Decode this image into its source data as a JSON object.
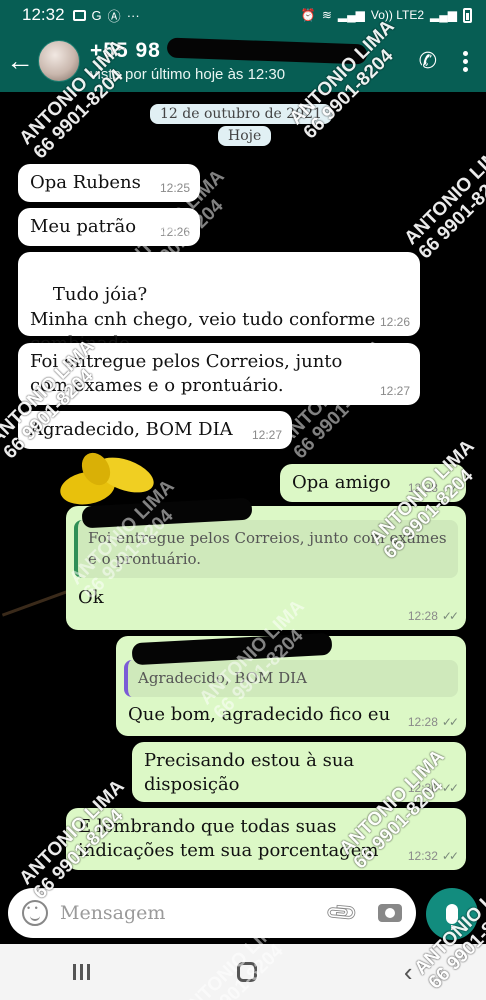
{
  "status_bar": {
    "time": "12:32",
    "icons": [
      "image-icon",
      "google-icon",
      "a-icon",
      "more-icon"
    ],
    "network": "Vo)) LTE2"
  },
  "header": {
    "phone_prefix": "+55 98",
    "last_seen": "visto por último hoje às 12:30"
  },
  "chat": {
    "date_label": "12 de outubro de 2021",
    "today_label": "Hoje",
    "messages": [
      {
        "dir": "in",
        "text": "Opa Rubens",
        "time": "12:25"
      },
      {
        "dir": "in",
        "text": "Meu patrão",
        "time": "12:26"
      },
      {
        "dir": "in",
        "text": "Tudo jóia?\nMinha cnh chego, veio tudo conforme combinado.",
        "time": "12:26"
      },
      {
        "dir": "in",
        "text": "Foi entregue pelos Correios, junto com exames e o prontuário.",
        "time": "12:27"
      },
      {
        "dir": "in",
        "text": "Agradecido, BOM DIA",
        "time": "12:27"
      },
      {
        "dir": "out",
        "text": "Opa amigo",
        "time": "12:28"
      },
      {
        "dir": "out",
        "quote": "Foi entregue pelos Correios, junto com exames e o prontuário.",
        "text": "Ok",
        "time": "12:28"
      },
      {
        "dir": "out",
        "quote": "Agradecido, BOM DIA",
        "text": "Que bom, agradecido fico eu",
        "time": "12:28"
      },
      {
        "dir": "out",
        "text": "Precisando estou à sua disposição",
        "time": "12:30"
      },
      {
        "dir": "out",
        "text": "E lembrando que todas suas indicações tem sua porcentagem",
        "time": "12:32"
      }
    ]
  },
  "input": {
    "placeholder": "Mensagem"
  },
  "watermark": {
    "name": "ANTONIO LIMA",
    "phone": "66 9901-8204"
  },
  "colors": {
    "header": "#075e54",
    "outgoing": "#dcf8c6",
    "incoming": "#ffffff",
    "mic": "#128c7e"
  }
}
